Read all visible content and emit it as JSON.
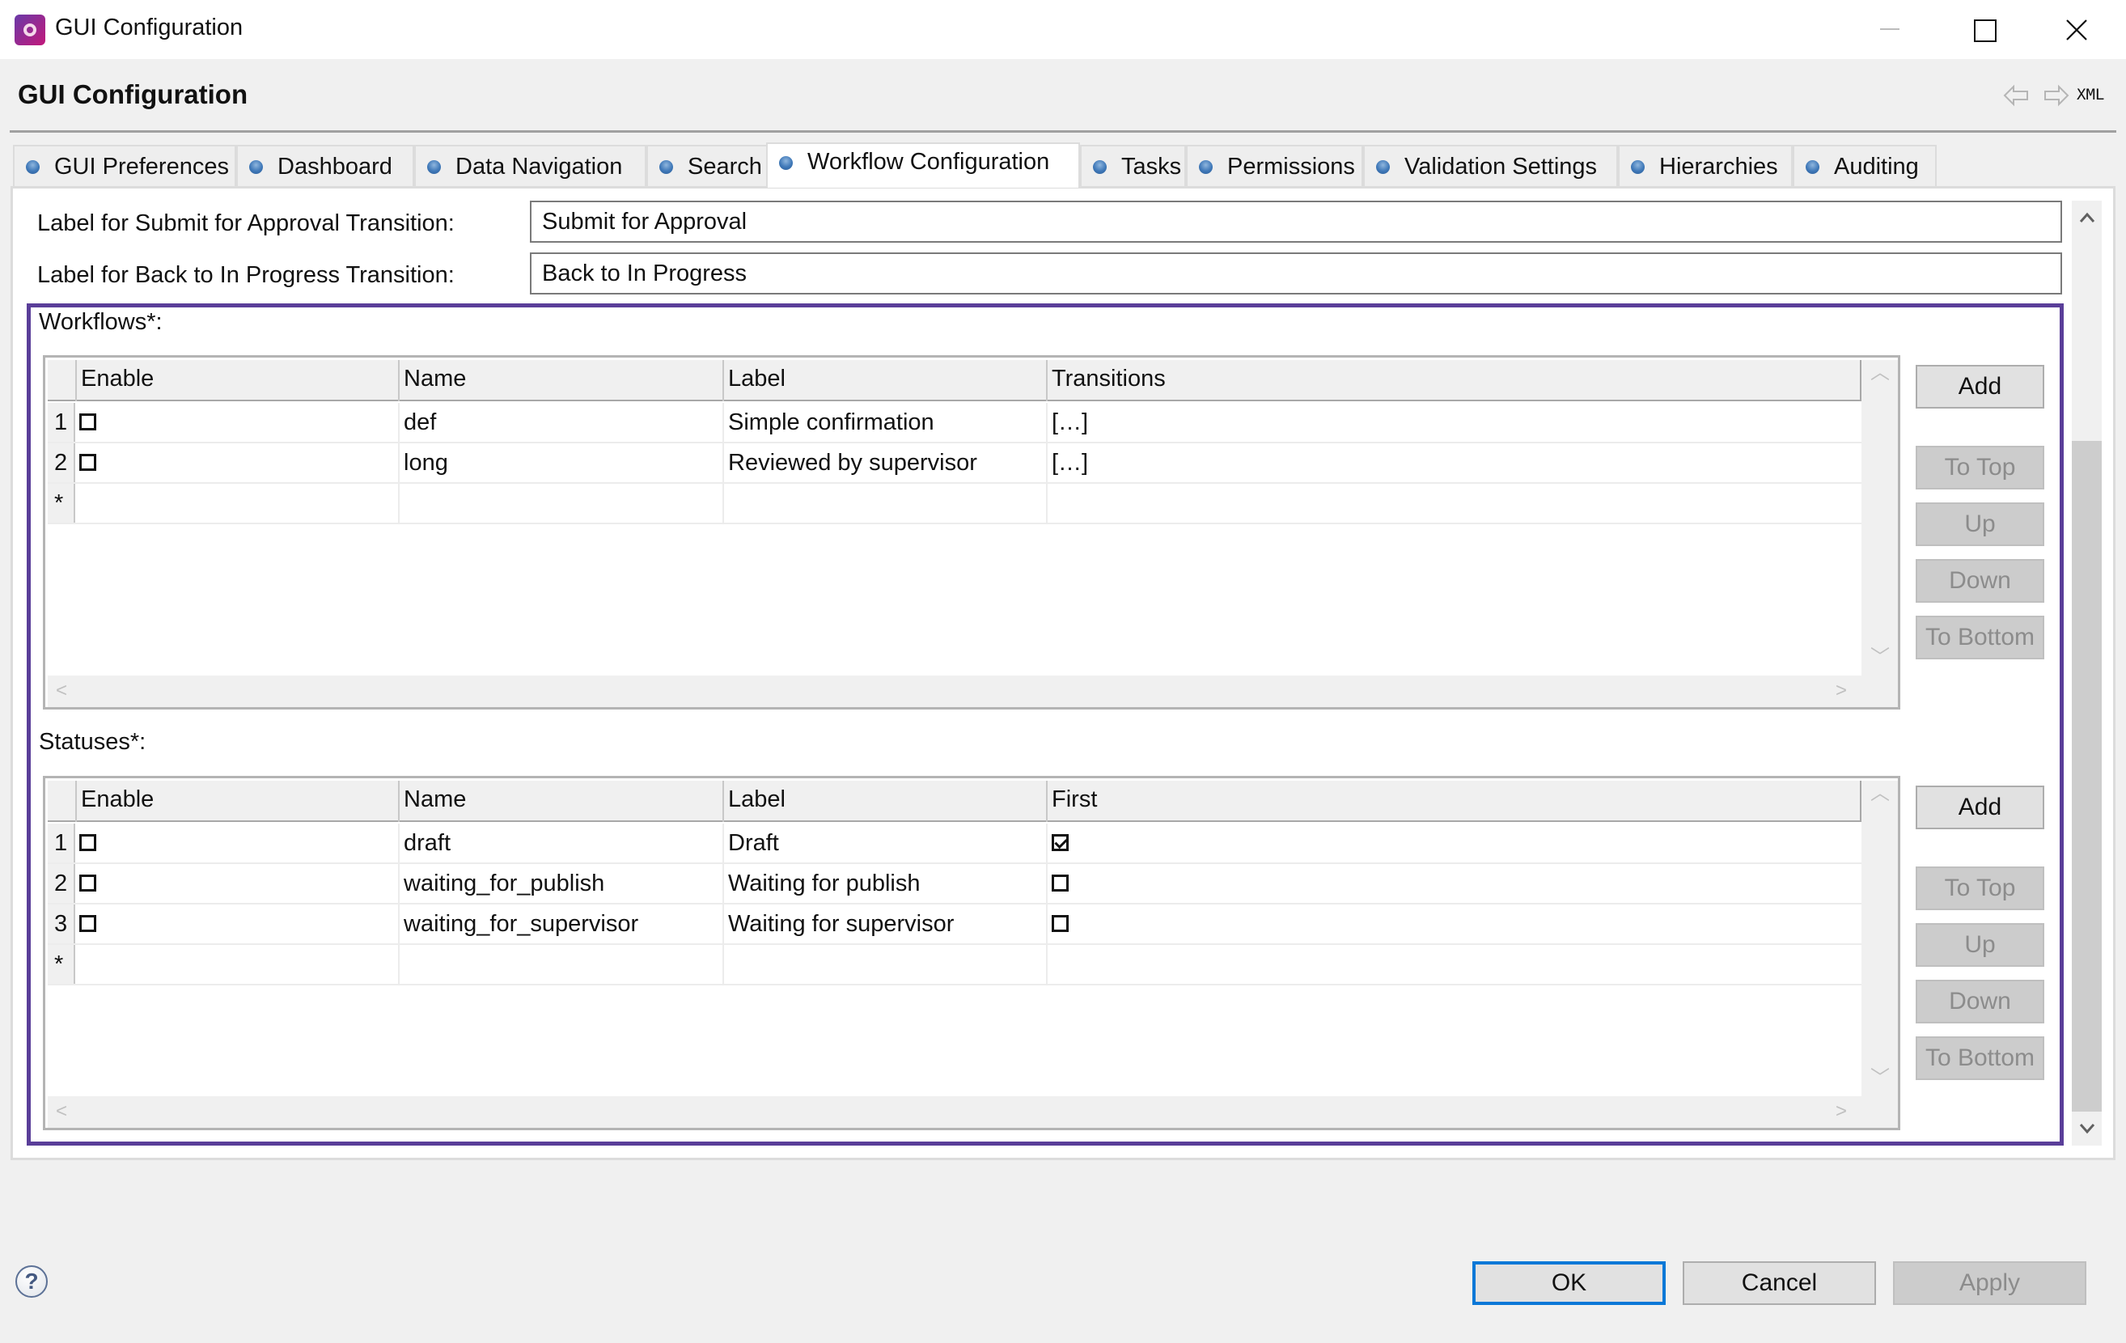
{
  "window": {
    "title": "GUI Configuration",
    "controls": [
      "minimize",
      "maximize",
      "close"
    ]
  },
  "header": {
    "title": "GUI Configuration",
    "nav_back_icon": "left-arrow-icon",
    "nav_forward_icon": "right-arrow-icon",
    "xml_label": "XML"
  },
  "tabs": [
    {
      "label": "GUI Preferences",
      "active": false
    },
    {
      "label": "Dashboard",
      "active": false
    },
    {
      "label": "Data Navigation",
      "active": false
    },
    {
      "label": "Search",
      "active": false
    },
    {
      "label": "Workflow Configuration",
      "active": true
    },
    {
      "label": "Tasks",
      "active": false
    },
    {
      "label": "Permissions",
      "active": false
    },
    {
      "label": "Validation Settings",
      "active": false
    },
    {
      "label": "Hierarchies",
      "active": false
    },
    {
      "label": "Auditing",
      "active": false
    }
  ],
  "form": {
    "submit_label": "Label for Submit for Approval Transition:",
    "submit_value": "Submit for Approval",
    "back_label": "Label for Back to In Progress Transition:",
    "back_value": "Back to In Progress"
  },
  "workflows": {
    "title": "Workflows*:",
    "columns": [
      "Enable",
      "Name",
      "Label",
      "Transitions"
    ],
    "rows": [
      {
        "num": "1",
        "enable": false,
        "name": "def",
        "label": "Simple confirmation",
        "transitions": "[…]"
      },
      {
        "num": "2",
        "enable": false,
        "name": "long",
        "label": "Reviewed by supervisor",
        "transitions": "[…]"
      }
    ],
    "new_row_marker": "*"
  },
  "statuses": {
    "title": "Statuses*:",
    "columns": [
      "Enable",
      "Name",
      "Label",
      "First"
    ],
    "rows": [
      {
        "num": "1",
        "enable": false,
        "name": "draft",
        "label": "Draft",
        "first": true
      },
      {
        "num": "2",
        "enable": false,
        "name": "waiting_for_publish",
        "label": "Waiting for publish",
        "first": false
      },
      {
        "num": "3",
        "enable": false,
        "name": "waiting_for_supervisor",
        "label": "Waiting for supervisor",
        "first": false
      }
    ],
    "new_row_marker": "*"
  },
  "side_buttons": {
    "add": "Add",
    "to_top": "To Top",
    "up": "Up",
    "down": "Down",
    "to_bottom": "To Bottom"
  },
  "footer": {
    "ok": "OK",
    "cancel": "Cancel",
    "apply": "Apply",
    "help_glyph": "?"
  },
  "colors": {
    "group_border": "#5a3e99",
    "default_button_border": "#0a78d7",
    "tab_dot": "#3f78b8"
  }
}
